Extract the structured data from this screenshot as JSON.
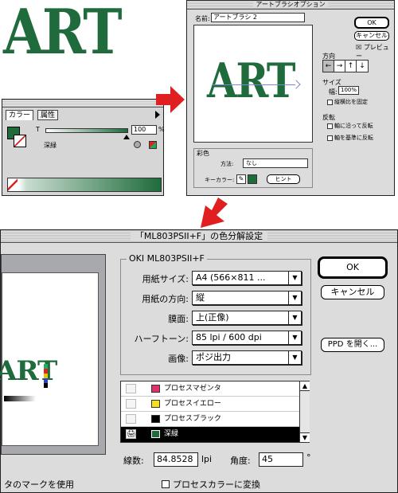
{
  "art_sample": {
    "text": "ART"
  },
  "palette": {
    "tab_color": "カラー",
    "tab_attr": "属性",
    "tint_label": "T",
    "tint_value": "100",
    "pct_sign": "%",
    "swatch_name": "深緑",
    "fill_color": "#1f6b3c"
  },
  "art_brush": {
    "title": "アートブラシオプション",
    "name_label": "名前:",
    "name_value": "アートブラシ 2",
    "ok": "OK",
    "cancel": "キャンセル",
    "preview": "☒ プレビュー",
    "preview_text": "ART",
    "direction_label": "方向",
    "dir_buttons": [
      "←",
      "→",
      "↑",
      "↓"
    ],
    "size_label": "サイズ",
    "width_label": "幅:",
    "width_value": "100%",
    "keep_ratio": "縦横比を固定",
    "flip_label": "反転",
    "flip_along": "軸に沿って反転",
    "flip_across": "軸を基準に反転",
    "colorize_label": "彩色",
    "method_label": "方法:",
    "method_value": "なし",
    "key_label": "キーカラー:",
    "hint": "ヒント"
  },
  "print_dialog": {
    "title": "「ML803PSII+F」の色分解設定",
    "group_title": "OKI ML803PSII+F",
    "rows": [
      {
        "label": "用紙サイズ:",
        "value": "A4 (566×811 ..."
      },
      {
        "label": "用紙の方向:",
        "value": "縦"
      },
      {
        "label": "膜面:",
        "value": "上(正像)"
      },
      {
        "label": "ハーフトーン:",
        "value": "85 lpi / 600 dpi"
      },
      {
        "label": "画像:",
        "value": "ポジ出力"
      }
    ],
    "ok": "OK",
    "cancel": "キャンセル",
    "ppd": "PPD を開く...",
    "inks": [
      {
        "name": "プロセスマゼンタ",
        "color": "#e0306a",
        "selected": false
      },
      {
        "name": "プロセスイエロー",
        "color": "#f2e11c",
        "selected": false
      },
      {
        "name": "プロセスブラック",
        "color": "#000000",
        "selected": false
      },
      {
        "name": "深緑",
        "color": "#1f6b3c",
        "selected": true
      }
    ],
    "printer_icon": "🖨",
    "lines_label": "線数:",
    "lines_value": "84.8528",
    "lines_unit": "lpi",
    "angle_label": "角度:",
    "angle_value": "45",
    "angle_unit": "°",
    "marks_text": "タのマークを使用",
    "convert_text": "プロセスカラーに変換",
    "preview_text": "ART"
  }
}
